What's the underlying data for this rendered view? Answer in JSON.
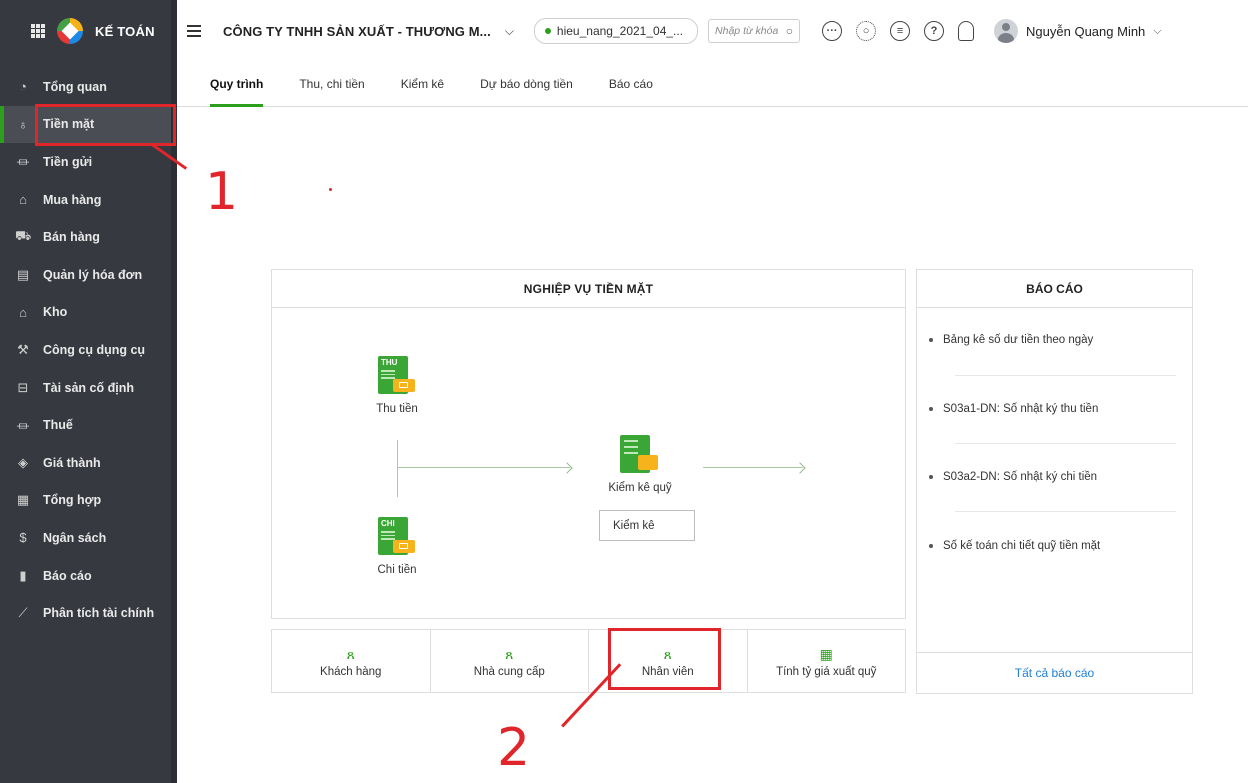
{
  "app": {
    "brand": "KẾ TOÁN"
  },
  "sidebar": {
    "items": [
      {
        "label": "Tổng quan",
        "icon": "gauge-icon",
        "glyph": "◔"
      },
      {
        "label": "Tiền mặt",
        "icon": "money-bag-icon",
        "glyph": "♁",
        "active": true
      },
      {
        "label": "Tiền gửi",
        "icon": "bank-icon",
        "glyph": "⏛"
      },
      {
        "label": "Mua hàng",
        "icon": "shopping-bag-icon",
        "glyph": "⌂"
      },
      {
        "label": "Bán hàng",
        "icon": "cart-icon",
        "glyph": "⛟"
      },
      {
        "label": "Quản lý hóa đơn",
        "icon": "invoice-icon",
        "glyph": "▤"
      },
      {
        "label": "Kho",
        "icon": "warehouse-icon",
        "glyph": "⌂"
      },
      {
        "label": "Công cụ dụng cụ",
        "icon": "tools-icon",
        "glyph": "⚒"
      },
      {
        "label": "Tài sản cố định",
        "icon": "asset-icon",
        "glyph": "⊟"
      },
      {
        "label": "Thuế",
        "icon": "tax-icon",
        "glyph": "⏛"
      },
      {
        "label": "Giá thành",
        "icon": "price-tag-icon",
        "glyph": "◈"
      },
      {
        "label": "Tổng hợp",
        "icon": "summary-icon",
        "glyph": "▦"
      },
      {
        "label": "Ngân sách",
        "icon": "budget-icon",
        "glyph": "$"
      },
      {
        "label": "Báo cáo",
        "icon": "bar-chart-icon",
        "glyph": "▮"
      },
      {
        "label": "Phân tích tài chính",
        "icon": "line-chart-icon",
        "glyph": "⟋"
      }
    ]
  },
  "header": {
    "company": "CÔNG TY TNHH SẢN XUẤT - THƯƠNG M...",
    "database": "hieu_nang_2021_04_...",
    "search_placeholder": "Nhập từ khóa",
    "user_name": "Nguyễn Quang Minh"
  },
  "tabs": [
    "Quy trình",
    "Thu, chi tiền",
    "Kiểm kê",
    "Dự báo dòng tiền",
    "Báo cáo"
  ],
  "process": {
    "title": "NGHIỆP VỤ TIỀN MẶT",
    "thu_tag": "THU",
    "thu_label": "Thu tiền",
    "chi_tag": "CHI",
    "chi_label": "Chi tiền",
    "kiemke_label": "Kiểm kê quỹ",
    "kiemke_button": "Kiểm kê"
  },
  "shortcuts": [
    {
      "label": "Khách hàng",
      "icon": "customer-icon",
      "glyph": "ጸ"
    },
    {
      "label": "Nhà cung cấp",
      "icon": "supplier-icon",
      "glyph": "ጸ"
    },
    {
      "label": "Nhân viên",
      "icon": "employee-icon",
      "glyph": "ጸ"
    },
    {
      "label": "Tính tỷ giá xuất quỹ",
      "icon": "calculator-icon",
      "glyph": "▦"
    }
  ],
  "reports": {
    "title": "BÁO CÁO",
    "items": [
      "Bảng kê số dư tiền theo ngày",
      "S03a1-DN: Số nhật ký thu tiền",
      "S03a2-DN: Số nhật ký chi tiền",
      "Số kế toán chi tiết quỹ tiền mặt"
    ],
    "all_link": "Tất cả báo cáo"
  },
  "annotations": [
    "1",
    "2"
  ],
  "colors": {
    "accent": "#2ca01c",
    "highlight": "#e0262b",
    "sidebar": "#36393f",
    "link": "#1e7fd6"
  }
}
